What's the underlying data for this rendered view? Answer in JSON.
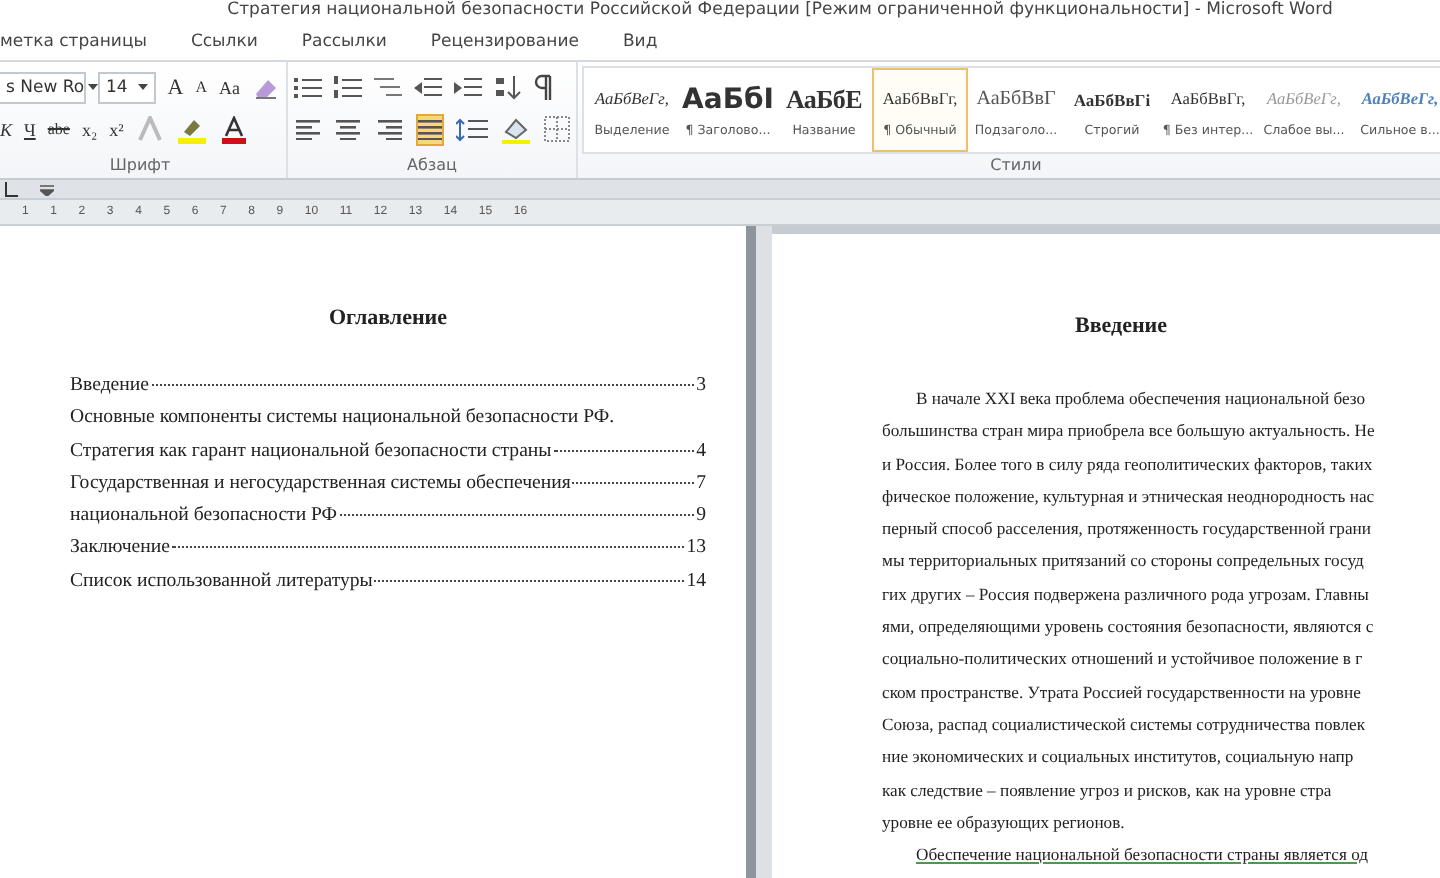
{
  "window": {
    "title": "Стратегия национальной безопасности Российской Федерации [Режим ограниченной функциональности]  -  Microsoft Word"
  },
  "tabs": [
    {
      "label": "метка страницы",
      "selected": false
    },
    {
      "label": "Ссылки",
      "selected": false
    },
    {
      "label": "Рассылки",
      "selected": false
    },
    {
      "label": "Рецензирование",
      "selected": false
    },
    {
      "label": "Вид",
      "selected": false
    }
  ],
  "font_group": {
    "label": "Шрифт",
    "font_name": "s New Ro",
    "font_size": "14",
    "grow": "A",
    "shrink": "A",
    "case": "Aa",
    "italic": "К",
    "underline": "Ч",
    "strike": "abe",
    "subscript": "x₂",
    "superscript": "x²"
  },
  "paragraph_group": {
    "label": "Абзац",
    "alignments": [
      {
        "selected": false
      },
      {
        "selected": false
      },
      {
        "selected": false
      },
      {
        "selected": true
      }
    ]
  },
  "styles_group": {
    "label": "Стили",
    "items": [
      {
        "preview": "АаБбВеГг,",
        "name": "Выделение",
        "kind": "italic",
        "selected": false
      },
      {
        "preview": "АаБбI",
        "name": "¶ Заголово...",
        "kind": "heading1",
        "selected": false
      },
      {
        "preview": "АаБбЕ",
        "name": "Название",
        "kind": "title",
        "selected": false
      },
      {
        "preview": "АаБбВвГг,",
        "name": "¶ Обычный",
        "kind": "normal",
        "selected": true
      },
      {
        "preview": "АаБбВвГ",
        "name": "Подзаголо...",
        "kind": "subtitle",
        "selected": false
      },
      {
        "preview": "АаБбВвГі",
        "name": "Строгий",
        "kind": "strong",
        "selected": false
      },
      {
        "preview": "АаБбВвГг,",
        "name": "¶ Без интер...",
        "kind": "normal",
        "selected": false
      },
      {
        "preview": "АаБбВеГг,",
        "name": "Слабое вы...",
        "kind": "subtle",
        "selected": false
      },
      {
        "preview": "АаБбВеГг,",
        "name": "Сильное в...",
        "kind": "intense",
        "selected": false
      }
    ]
  },
  "ruler": {
    "ticks": [
      "1",
      "1",
      "2",
      "3",
      "4",
      "5",
      "6",
      "7",
      "8",
      "9",
      "10",
      "11",
      "12",
      "13",
      "14",
      "15",
      "16"
    ]
  },
  "left_page": {
    "heading": "Оглавление",
    "toc": [
      {
        "text": "Введение",
        "page": "3"
      },
      {
        "text": "Основные компоненты системы национальной безопасности РФ."
      },
      {
        "text": "Стратегия как гарант национальной безопасности страны",
        "page": "4"
      },
      {
        "text": "Государственная и негосударственная системы обеспечения",
        "page": "7"
      },
      {
        "text": "национальной безопасности РФ",
        "page": "9"
      },
      {
        "text": "Заключение",
        "page": "13"
      },
      {
        "text": "Список использованной литературы",
        "page": "14"
      }
    ]
  },
  "right_page": {
    "heading": "Введение",
    "lines": [
      {
        "text": "В начале XXI века проблема обеспечения национальной безо",
        "kind": "indent"
      },
      {
        "text": "большинства стран мира приобрела все большую актуальность. Не",
        "kind": "plain"
      },
      {
        "text": "и Россия. Более того в силу ряда геополитических факторов,  таких",
        "kind": "plain"
      },
      {
        "text": "фическое положение, культурная и этническая неоднородность нас",
        "kind": "plain"
      },
      {
        "text": "перный способ расселения, протяженность государственной грани",
        "kind": "plain"
      },
      {
        "text": "мы территориальных притязаний со стороны сопредельных госуд",
        "kind": "plain"
      },
      {
        "text": "гих других – Россия подвержена различного рода угрозам. Главны",
        "kind": "plain"
      },
      {
        "text": "ями, определяющими уровень состояния безопасности, являются с",
        "kind": "plain"
      },
      {
        "text": "социально-политических отношений и устойчивое положение в г",
        "kind": "plain"
      },
      {
        "text": "ском пространстве. Утрата Россией государственности на уровне",
        "kind": "plain"
      },
      {
        "text": "Союза, распад социалистической системы сотрудничества повлек",
        "kind": "plain"
      },
      {
        "text": "ние экономических и социальных институтов, социальную напр",
        "kind": "plain"
      },
      {
        "text": "как следствие – появление угроз и рисков, как на уровне стра",
        "kind": "plain"
      },
      {
        "text": "уровне ее образующих регионов.",
        "kind": "plain"
      },
      {
        "text": "Обеспечение национальной безопасности страны является од",
        "kind": "marked"
      }
    ]
  }
}
